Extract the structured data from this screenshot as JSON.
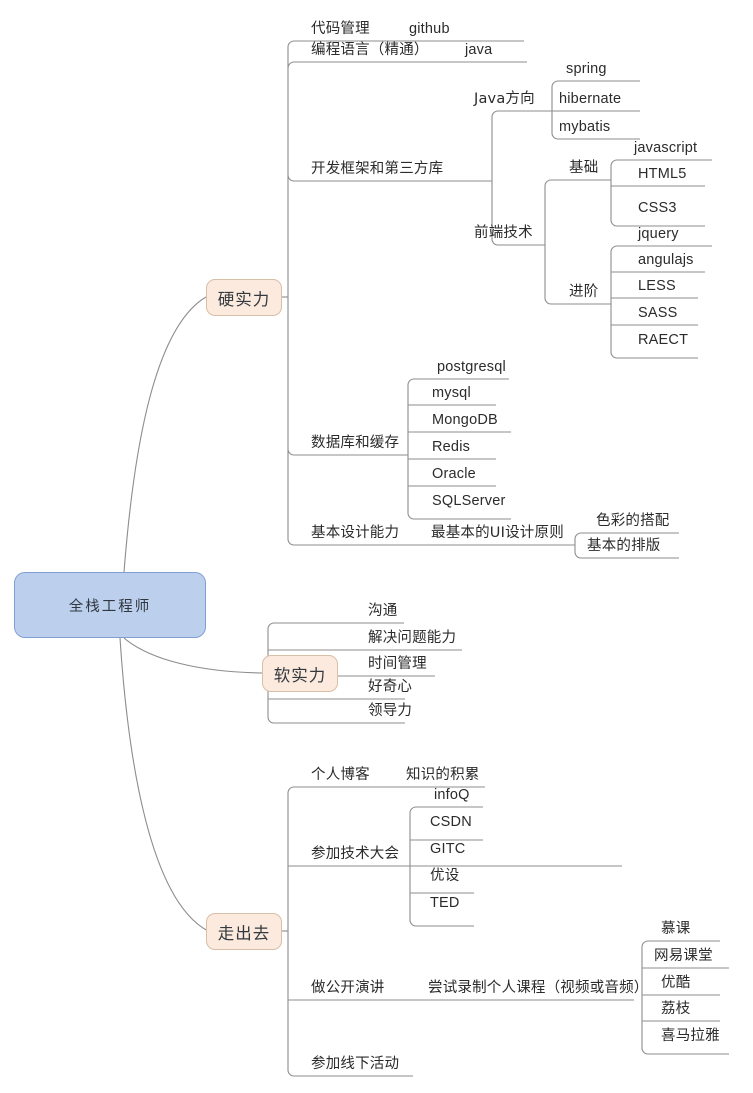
{
  "diagram": {
    "title": "全栈工程师",
    "colors": {
      "root_fill": "#bcd0ee",
      "root_border": "#7f9fd4",
      "branch_fill": "#fbeadd",
      "branch_border": "#d7bfa8",
      "line": "#8d8d8d",
      "text": "#2b2b2b",
      "background": "#ffffff"
    }
  },
  "root": {
    "label": "全栈工程师"
  },
  "branches": [
    {
      "id": "hard",
      "label": "硬实力"
    },
    {
      "id": "soft",
      "label": "软实力"
    },
    {
      "id": "out",
      "label": "走出去"
    }
  ],
  "hard": {
    "items": [
      {
        "label": "代码管理",
        "children": [
          "github"
        ]
      },
      {
        "label": "编程语言（精通）",
        "children": [
          "java"
        ]
      },
      {
        "label": "开发框架和第三方库",
        "children": []
      },
      {
        "label": "数据库和缓存",
        "children": []
      },
      {
        "label": "基本设计能力",
        "children": []
      }
    ],
    "code_management": {
      "label": "代码管理",
      "value": "github"
    },
    "language": {
      "label": "编程语言（精通）",
      "value": "java"
    },
    "frameworks": {
      "label": "开发框架和第三方库",
      "groups": [
        {
          "label": "Java方向",
          "items": [
            "spring",
            "hibernate",
            "mybatis"
          ]
        },
        {
          "label": "前端技术",
          "subgroups": [
            {
              "label": "基础",
              "items": [
                "javascript",
                "HTML5",
                "CSS3"
              ]
            },
            {
              "label": "进阶",
              "items": [
                "jquery",
                "angulajs",
                "LESS",
                "SASS",
                "RAECT"
              ]
            }
          ]
        }
      ]
    },
    "database": {
      "label": "数据库和缓存",
      "items": [
        "postgresql",
        "mysql",
        "MongoDB",
        "Redis",
        "Oracle",
        "SQLServer"
      ]
    },
    "design": {
      "label": "基本设计能力",
      "principle": "最基本的UI设计原则",
      "items": [
        "色彩的搭配",
        "基本的排版"
      ]
    }
  },
  "soft": {
    "label": "软实力",
    "items": [
      "沟通",
      "解决问题能力",
      "时间管理",
      "好奇心",
      "领导力"
    ]
  },
  "out": {
    "label": "走出去",
    "blog": {
      "label": "个人博客",
      "child": "知识的积累"
    },
    "conference": {
      "label": "参加技术大会",
      "items": [
        "infoQ",
        "CSDN",
        "GITC",
        "优设",
        "TED"
      ]
    },
    "speaking": {
      "label": "做公开演讲",
      "course": "尝试录制个人课程（视频或音频）",
      "platforms": [
        "慕课",
        "网易课堂",
        "优酷",
        "荔枝",
        "喜马拉雅"
      ]
    },
    "offline": {
      "label": "参加线下活动"
    }
  }
}
